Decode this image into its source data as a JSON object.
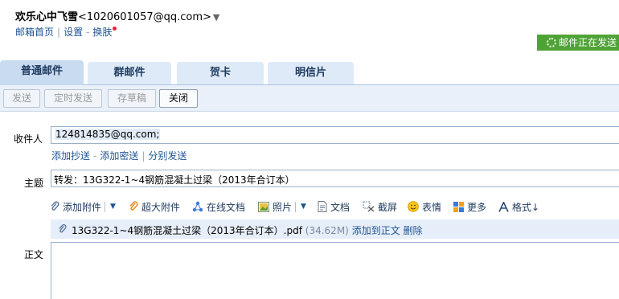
{
  "header": {
    "user_name": "欢乐心中飞雪",
    "user_email": "<1020601057@qq.com>",
    "caret": "▼",
    "links": {
      "home": "邮箱首页",
      "sep": "|",
      "settings": "设置",
      "dash": "-",
      "skin": "换肤"
    },
    "send_status": "邮件正在发送"
  },
  "tabs": [
    {
      "label": "普通邮件",
      "active": true
    },
    {
      "label": "群邮件",
      "active": false
    },
    {
      "label": "贺卡",
      "active": false
    },
    {
      "label": "明信片",
      "active": false
    }
  ],
  "toolbar": {
    "send": "发送",
    "scheduled_send": "定时发送",
    "save_draft": "存草稿",
    "close": "关闭"
  },
  "compose": {
    "to_label": "收件人",
    "recipient": "124814835@qq.com;",
    "add_cc": "添加抄送",
    "dash": "-",
    "add_bcc": "添加密送",
    "sep": "|",
    "separate_send": "分别发送",
    "subject_label": "主题",
    "subject_value": "转发：13G322-1~4钢筋混凝土过梁（2013年合订本）",
    "body_label": "正文"
  },
  "attach_toolbar": {
    "add_attachment": "添加附件",
    "large_attachment": "超大附件",
    "online_doc": "在线文档",
    "photo": "照片",
    "document": "文档",
    "screenshot": "截屏",
    "emoji": "表情",
    "more": "更多",
    "format": "格式↓"
  },
  "attachment": {
    "filename": "13G322-1~4钢筋混凝土过梁（2013年合订本）.pdf",
    "size": "(34.62M)",
    "add_to_body": "添加到正文",
    "delete": "删除"
  }
}
